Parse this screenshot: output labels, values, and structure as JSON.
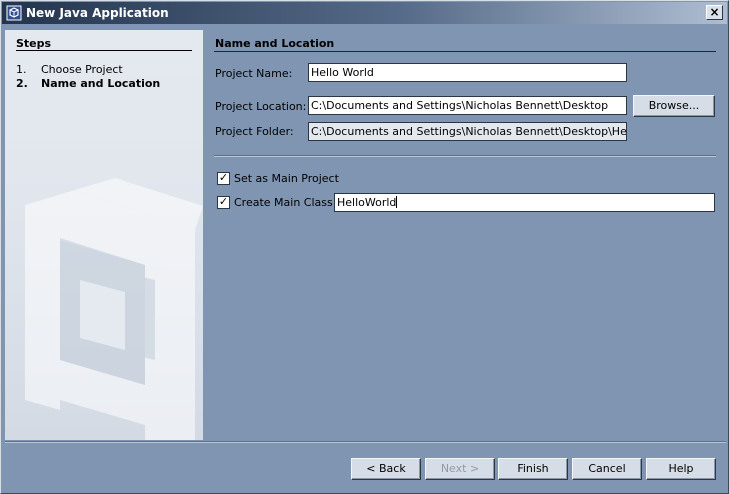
{
  "window": {
    "title": "New Java Application",
    "icon": "netbeans-cube-icon",
    "close_label": "×"
  },
  "steps": {
    "title": "Steps",
    "items": [
      {
        "num": "1.",
        "label": "Choose Project"
      },
      {
        "num": "2.",
        "label": "Name and Location"
      }
    ]
  },
  "form": {
    "section_title": "Name and Location",
    "project_name_label": "Project Name:",
    "project_name_value": "Hello World",
    "project_location_label": "Project Location:",
    "project_location_value": "C:\\Documents and Settings\\Nicholas Bennett\\Desktop",
    "browse_label": "Browse...",
    "project_folder_label": "Project Folder:",
    "project_folder_value": "C:\\Documents and Settings\\Nicholas Bennett\\Desktop\\Hello World",
    "main_project_label": "Set as Main Project",
    "main_project_checked": true,
    "main_class_label": "Create Main Class",
    "main_class_checked": true,
    "main_class_value": "HelloWorld",
    "check_mark": "✓"
  },
  "buttons": {
    "back": "< Back",
    "next": "Next >",
    "finish": "Finish",
    "cancel": "Cancel",
    "help": "Help"
  },
  "colors": {
    "dialog_bg": "#7f95b1",
    "title_gradient_start": "#23344d",
    "steps_bg": "#e4e9ef"
  }
}
